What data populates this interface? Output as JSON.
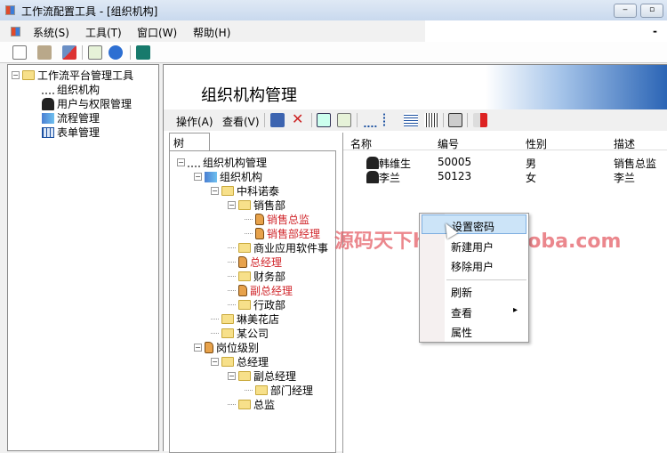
{
  "window": {
    "title": "工作流配置工具 - [组织机构]",
    "minimize": "‒",
    "restore": "▫"
  },
  "menubar": {
    "items": [
      "系统(S)",
      "工具(T)",
      "窗口(W)",
      "帮助(H)"
    ],
    "mdi_minimize": "-"
  },
  "toolbar": {
    "icons": [
      "new-icon",
      "copy-icon",
      "disconnect-icon",
      "refresh-icon",
      "help-icon",
      "exit-icon"
    ]
  },
  "left_tree": {
    "root": "工作流平台管理工具",
    "items": [
      "组织机构",
      "用户与权限管理",
      "流程管理",
      "表单管理"
    ]
  },
  "main": {
    "title": "组织机构管理",
    "toolbar": {
      "action": "操作(A)",
      "view": "查看(V)"
    },
    "tab": "树"
  },
  "org_tree": [
    {
      "label": "组织机构管理",
      "level": 0,
      "icon": "org",
      "exp": true
    },
    {
      "label": "组织机构",
      "level": 1,
      "icon": "org2",
      "exp": true
    },
    {
      "label": "中科诺泰",
      "level": 2,
      "icon": "folder",
      "exp": true
    },
    {
      "label": "销售部",
      "level": 3,
      "icon": "folder",
      "exp": true
    },
    {
      "label": "销售总监",
      "level": 4,
      "icon": "person",
      "red": true
    },
    {
      "label": "销售部经理",
      "level": 4,
      "icon": "person",
      "red": true
    },
    {
      "label": "商业应用软件事",
      "level": 3,
      "icon": "folder"
    },
    {
      "label": "总经理",
      "level": 3,
      "icon": "person",
      "red": true
    },
    {
      "label": "财务部",
      "level": 3,
      "icon": "folder"
    },
    {
      "label": "副总经理",
      "level": 3,
      "icon": "person",
      "red": true
    },
    {
      "label": "行政部",
      "level": 3,
      "icon": "folder"
    },
    {
      "label": "琳美花店",
      "level": 2,
      "icon": "folder"
    },
    {
      "label": "某公司",
      "level": 2,
      "icon": "folder"
    },
    {
      "label": "岗位级别",
      "level": 1,
      "icon": "person",
      "exp": true
    },
    {
      "label": "总经理",
      "level": 2,
      "icon": "folder",
      "exp": true
    },
    {
      "label": "副总经理",
      "level": 3,
      "icon": "folder",
      "exp": true
    },
    {
      "label": "部门经理",
      "level": 4,
      "icon": "folder"
    },
    {
      "label": "总监",
      "level": 3,
      "icon": "folder"
    }
  ],
  "list": {
    "columns": [
      "名称",
      "编号",
      "性别",
      "描述"
    ],
    "rows": [
      [
        "韩维生",
        "50005",
        "男",
        "销售总监"
      ],
      [
        "李兰",
        "50123",
        "女",
        "李兰"
      ]
    ]
  },
  "context_menu": {
    "items": [
      "设置密码",
      "新建用户",
      "移除用户",
      "刷新",
      "查看",
      "属性"
    ],
    "submenu_arrow": "▸"
  },
  "watermark": "源码天下huamay.taoba.com"
}
